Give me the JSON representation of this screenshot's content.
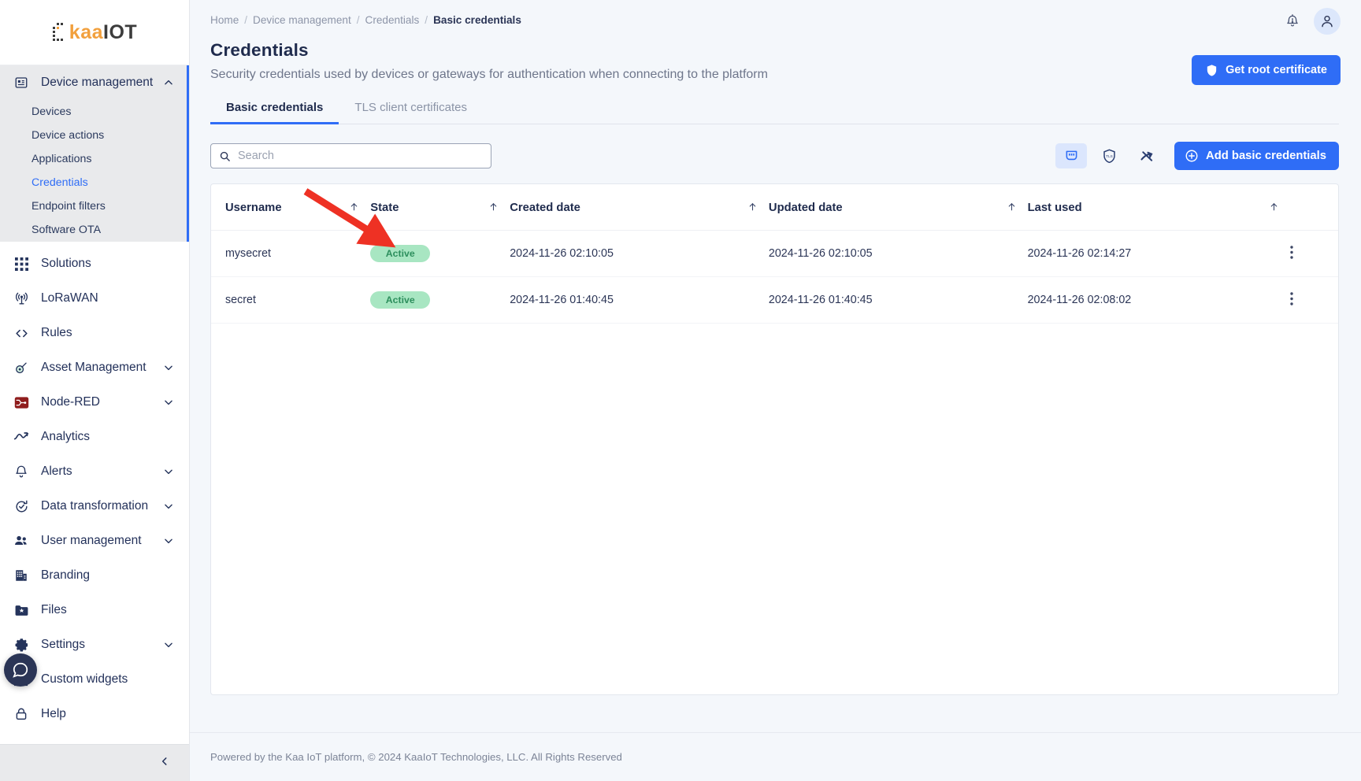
{
  "brand": {
    "logo_kaa": "kaa",
    "logo_iot": "IOT",
    "accent_blue": "#2f6df6",
    "badge_green_bg": "#a8e6c2",
    "badge_green_fg": "#2d8f5d",
    "annotation_red": "#ee3124"
  },
  "sidebar": {
    "group": {
      "label": "Device management",
      "icon": "device-chip-icon",
      "expanded": true,
      "children": [
        {
          "label": "Devices",
          "selected": false
        },
        {
          "label": "Device actions",
          "selected": false
        },
        {
          "label": "Applications",
          "selected": false
        },
        {
          "label": "Credentials",
          "selected": true
        },
        {
          "label": "Endpoint filters",
          "selected": false
        },
        {
          "label": "Software OTA",
          "selected": false
        }
      ]
    },
    "items": [
      {
        "label": "Solutions",
        "icon": "grid-dots-icon",
        "chevron": false
      },
      {
        "label": "LoRaWAN",
        "icon": "antenna-icon",
        "chevron": false
      },
      {
        "label": "Rules",
        "icon": "code-brackets-icon",
        "chevron": false
      },
      {
        "label": "Asset Management",
        "icon": "asset-tag-icon",
        "chevron": true
      },
      {
        "label": "Node-RED",
        "icon": "node-red-icon",
        "chevron": true
      },
      {
        "label": "Analytics",
        "icon": "analytics-chart-icon",
        "chevron": false
      },
      {
        "label": "Alerts",
        "icon": "bell-icon",
        "chevron": true
      },
      {
        "label": "Data transformation",
        "icon": "refresh-check-icon",
        "chevron": true
      },
      {
        "label": "User management",
        "icon": "users-icon",
        "chevron": true
      },
      {
        "label": "Branding",
        "icon": "building-icon",
        "chevron": false
      },
      {
        "label": "Files",
        "icon": "folder-star-icon",
        "chevron": false
      },
      {
        "label": "Settings",
        "icon": "gear-icon",
        "chevron": true
      },
      {
        "label": "Custom widgets",
        "icon": "widgets-icon",
        "chevron": false
      },
      {
        "label": "Help",
        "icon": "help-lock-icon",
        "chevron": false
      }
    ],
    "collapse_icon": "chevron-left-icon"
  },
  "header": {
    "breadcrumb": [
      {
        "label": "Home",
        "current": false
      },
      {
        "label": "Device management",
        "current": false
      },
      {
        "label": "Credentials",
        "current": false
      },
      {
        "label": "Basic credentials",
        "current": true
      }
    ],
    "separator": "/",
    "title": "Credentials",
    "subtitle": "Security credentials used by devices or gateways for authentication when connecting to the platform",
    "notifications_icon": "bell-alert-icon",
    "account_icon": "user-avatar-icon",
    "get_root_certificate": "Get root certificate",
    "get_root_certificate_icon": "shield-icon"
  },
  "tabs": [
    {
      "label": "Basic credentials",
      "active": true
    },
    {
      "label": "TLS client certificates",
      "active": false
    }
  ],
  "toolbar": {
    "search_placeholder": "Search",
    "search_value": "",
    "search_icon": "search-icon",
    "view_toggles": [
      {
        "name": "basic-credentials-filter",
        "icon": "connector-port-icon",
        "active": true
      },
      {
        "name": "tls-filter",
        "icon": "tls-shield-icon",
        "active": false
      },
      {
        "name": "no-credentials-filter",
        "icon": "disconnected-icon",
        "active": false
      }
    ],
    "add_button": "Add basic credentials",
    "add_button_icon": "plus-circle-icon"
  },
  "table": {
    "columns": [
      {
        "label": "Username",
        "sortable": true,
        "sort_icon": "arrow-up-icon"
      },
      {
        "label": "State",
        "sortable": true,
        "sort_icon": "arrow-up-icon"
      },
      {
        "label": "Created date",
        "sortable": true,
        "sort_icon": "arrow-up-icon"
      },
      {
        "label": "Updated date",
        "sortable": true,
        "sort_icon": "arrow-up-icon"
      },
      {
        "label": "Last used",
        "sortable": true,
        "sort_icon": "arrow-up-icon"
      }
    ],
    "rows": [
      {
        "username": "mysecret",
        "state": "Active",
        "created": "2024-11-26 02:10:05",
        "updated": "2024-11-26 02:10:05",
        "last_used": "2024-11-26 02:14:27",
        "menu_icon": "kebab-menu-icon"
      },
      {
        "username": "secret",
        "state": "Active",
        "created": "2024-11-26 01:40:45",
        "updated": "2024-11-26 01:40:45",
        "last_used": "2024-11-26 02:08:02",
        "menu_icon": "kebab-menu-icon"
      }
    ]
  },
  "footer": {
    "text": "Powered by the Kaa IoT platform, © 2024 KaaIoT Technologies, LLC. All Rights Reserved"
  },
  "annotation": {
    "type": "arrow",
    "color": "#ee3124",
    "points_to": "state-badge-row-0"
  }
}
